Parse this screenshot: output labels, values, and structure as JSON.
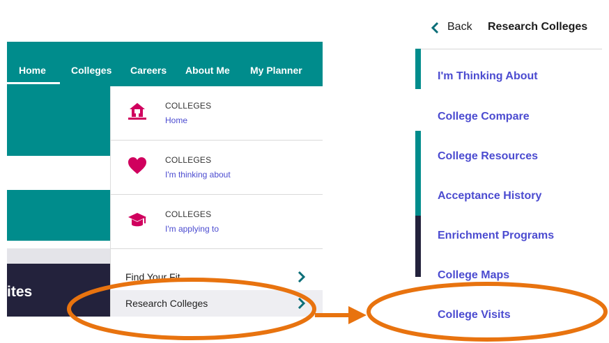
{
  "left_screen": {
    "nav": {
      "items": [
        "Home",
        "Colleges",
        "Careers",
        "About Me",
        "My Planner"
      ],
      "active": "Home"
    },
    "background_text": "ites",
    "dropdown": {
      "cards": [
        {
          "category": "COLLEGES",
          "sub": "Home",
          "icon": "school-house-icon"
        },
        {
          "category": "COLLEGES",
          "sub": "I'm thinking about",
          "icon": "heart-icon"
        },
        {
          "category": "COLLEGES",
          "sub": "I'm applying to",
          "icon": "graduation-cap-icon"
        }
      ],
      "links": [
        {
          "label": "Find Your Fit",
          "active": false
        },
        {
          "label": "Research Colleges",
          "active": true
        }
      ]
    }
  },
  "right_screen": {
    "back_label": "Back",
    "title": "Research Colleges",
    "items": [
      "I'm Thinking About",
      "College Compare",
      "College Resources",
      "Acceptance History",
      "Enrichment Programs",
      "College Maps",
      "College Visits"
    ]
  },
  "colors": {
    "teal": "#008c8c",
    "link_purple": "#4b4bd0",
    "icon_pink": "#d0005e",
    "annotation_orange": "#e8730f",
    "navy": "#23223c"
  }
}
